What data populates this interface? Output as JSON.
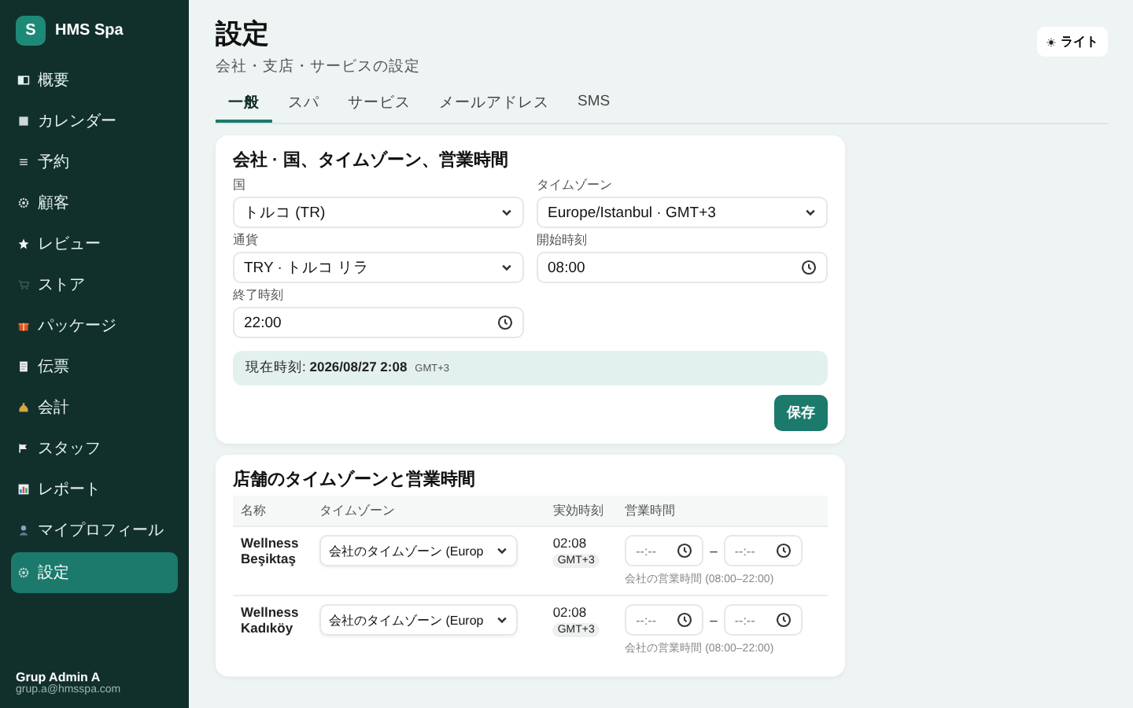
{
  "sidebar": {
    "brand": {
      "initial": "S",
      "name": "HMS Spa"
    },
    "items": [
      {
        "kind": "panel",
        "label": "概要",
        "selected": false
      },
      {
        "kind": "square",
        "label": "カレンダー",
        "selected": false
      },
      {
        "kind": "lines",
        "label": "予約",
        "selected": false
      },
      {
        "kind": "gear",
        "label": "顧客",
        "selected": false
      },
      {
        "kind": "star",
        "label": "レビュー",
        "selected": false
      },
      {
        "kind": "cart",
        "label": "ストア",
        "selected": false
      },
      {
        "kind": "gift",
        "label": "パッケージ",
        "selected": false
      },
      {
        "kind": "receipt",
        "label": "伝票",
        "selected": false
      },
      {
        "kind": "bag",
        "label": "会計",
        "selected": false
      },
      {
        "kind": "flag",
        "label": "スタッフ",
        "selected": false
      },
      {
        "kind": "chart",
        "label": "レポート",
        "selected": false
      },
      {
        "kind": "person",
        "label": "マイプロフィール",
        "selected": false
      },
      {
        "kind": "gear",
        "label": "設定",
        "selected": true
      }
    ],
    "user": {
      "name": "Grup Admin A",
      "email": "grup.a@hmsspa.com"
    }
  },
  "header": {
    "title": "設定",
    "subtitle": "会社・支店・サービスの設定",
    "theme_button": {
      "label": "ライト"
    }
  },
  "tabs": [
    {
      "label": "一般",
      "selected": true
    },
    {
      "label": "スパ",
      "selected": false
    },
    {
      "label": "サービス",
      "selected": false
    },
    {
      "label": "メールアドレス",
      "selected": false
    },
    {
      "label": "SMS",
      "selected": false
    }
  ],
  "company_card": {
    "title": "会社 · 国、タイムゾーン、営業時間",
    "fields": [
      {
        "kind": "select",
        "label": "国",
        "value": "トルコ (TR)"
      },
      {
        "kind": "select",
        "label": "タイムゾーン",
        "value": "Europe/Istanbul · GMT+3"
      },
      {
        "kind": "select",
        "label": "通貨",
        "value": "TRY · トルコ リラ"
      },
      {
        "kind": "time",
        "label": "開始時刻",
        "value": "08:00"
      },
      {
        "kind": "time",
        "label": "終了時刻",
        "value": "22:00"
      }
    ],
    "current_time": {
      "label": "現在時刻:",
      "value": "2026/08/27 2:08",
      "zone": "GMT+3"
    },
    "save_button": "保存"
  },
  "branches_card": {
    "title": "店舗のタイムゾーンと営業時間",
    "columns": [
      "名称",
      "タイムゾーン",
      "実効時刻",
      "営業時間"
    ],
    "rows": [
      {
        "name": "Wellness Beşiktaş",
        "timezone": "会社のタイムゾーン (Europ",
        "time": "02:08",
        "zone": "GMT+3",
        "open_placeholder": "--:--",
        "separator": "–",
        "close_placeholder": "--:--",
        "hint": "会社の営業時間 (08:00–22:00)"
      },
      {
        "name": "Wellness Kadıköy",
        "timezone": "会社のタイムゾーン (Europ",
        "time": "02:08",
        "zone": "GMT+3",
        "open_placeholder": "--:--",
        "separator": "–",
        "close_placeholder": "--:--",
        "hint": "会社の営業時間 (08:00–22:00)"
      }
    ]
  }
}
